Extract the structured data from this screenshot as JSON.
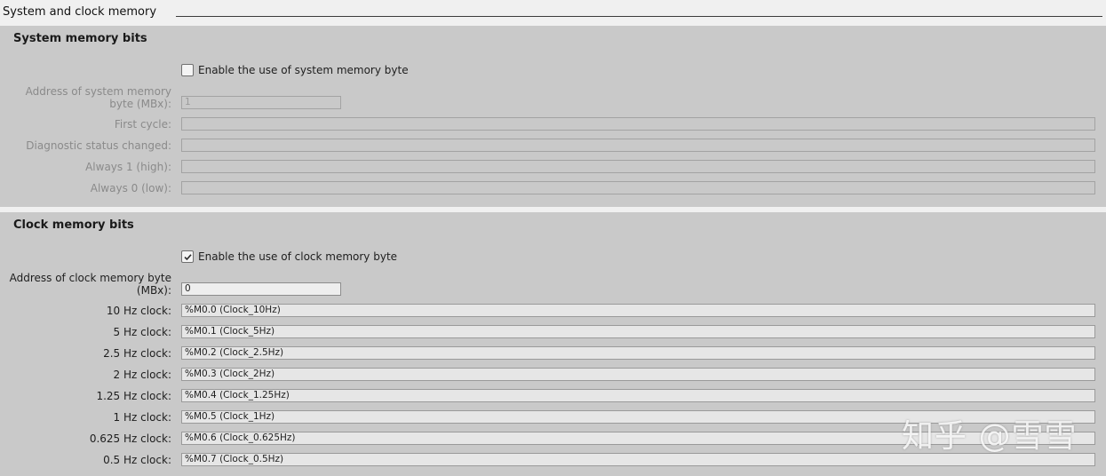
{
  "header": {
    "title": "System and clock memory"
  },
  "system_memory": {
    "title": "System memory bits",
    "enable_label": "Enable the use of system memory byte",
    "enabled": false,
    "address_label_line1": "Address of system memory",
    "address_label_line2": "byte (MBx):",
    "address_value": "1",
    "fields": [
      {
        "label": "First cycle:",
        "value": ""
      },
      {
        "label": "Diagnostic status changed:",
        "value": ""
      },
      {
        "label": "Always 1 (high):",
        "value": ""
      },
      {
        "label": "Always 0 (low):",
        "value": ""
      }
    ]
  },
  "clock_memory": {
    "title": "Clock memory bits",
    "enable_label": "Enable the use of clock memory byte",
    "enabled": true,
    "address_label_line1": "Address of clock memory byte",
    "address_label_line2": "(MBx):",
    "address_value": "0",
    "clocks": [
      {
        "label": "10 Hz clock:",
        "value": "%M0.0 (Clock_10Hz)"
      },
      {
        "label": "5 Hz clock:",
        "value": "%M0.1 (Clock_5Hz)"
      },
      {
        "label": "2.5 Hz clock:",
        "value": "%M0.2 (Clock_2.5Hz)"
      },
      {
        "label": "2 Hz clock:",
        "value": "%M0.3 (Clock_2Hz)"
      },
      {
        "label": "1.25 Hz clock:",
        "value": "%M0.4 (Clock_1.25Hz)"
      },
      {
        "label": "1 Hz clock:",
        "value": "%M0.5 (Clock_1Hz)"
      },
      {
        "label": "0.625 Hz clock:",
        "value": "%M0.6 (Clock_0.625Hz)"
      },
      {
        "label": "0.5 Hz clock:",
        "value": "%M0.7 (Clock_0.5Hz)"
      }
    ]
  },
  "watermark": "知乎 @雪雪"
}
